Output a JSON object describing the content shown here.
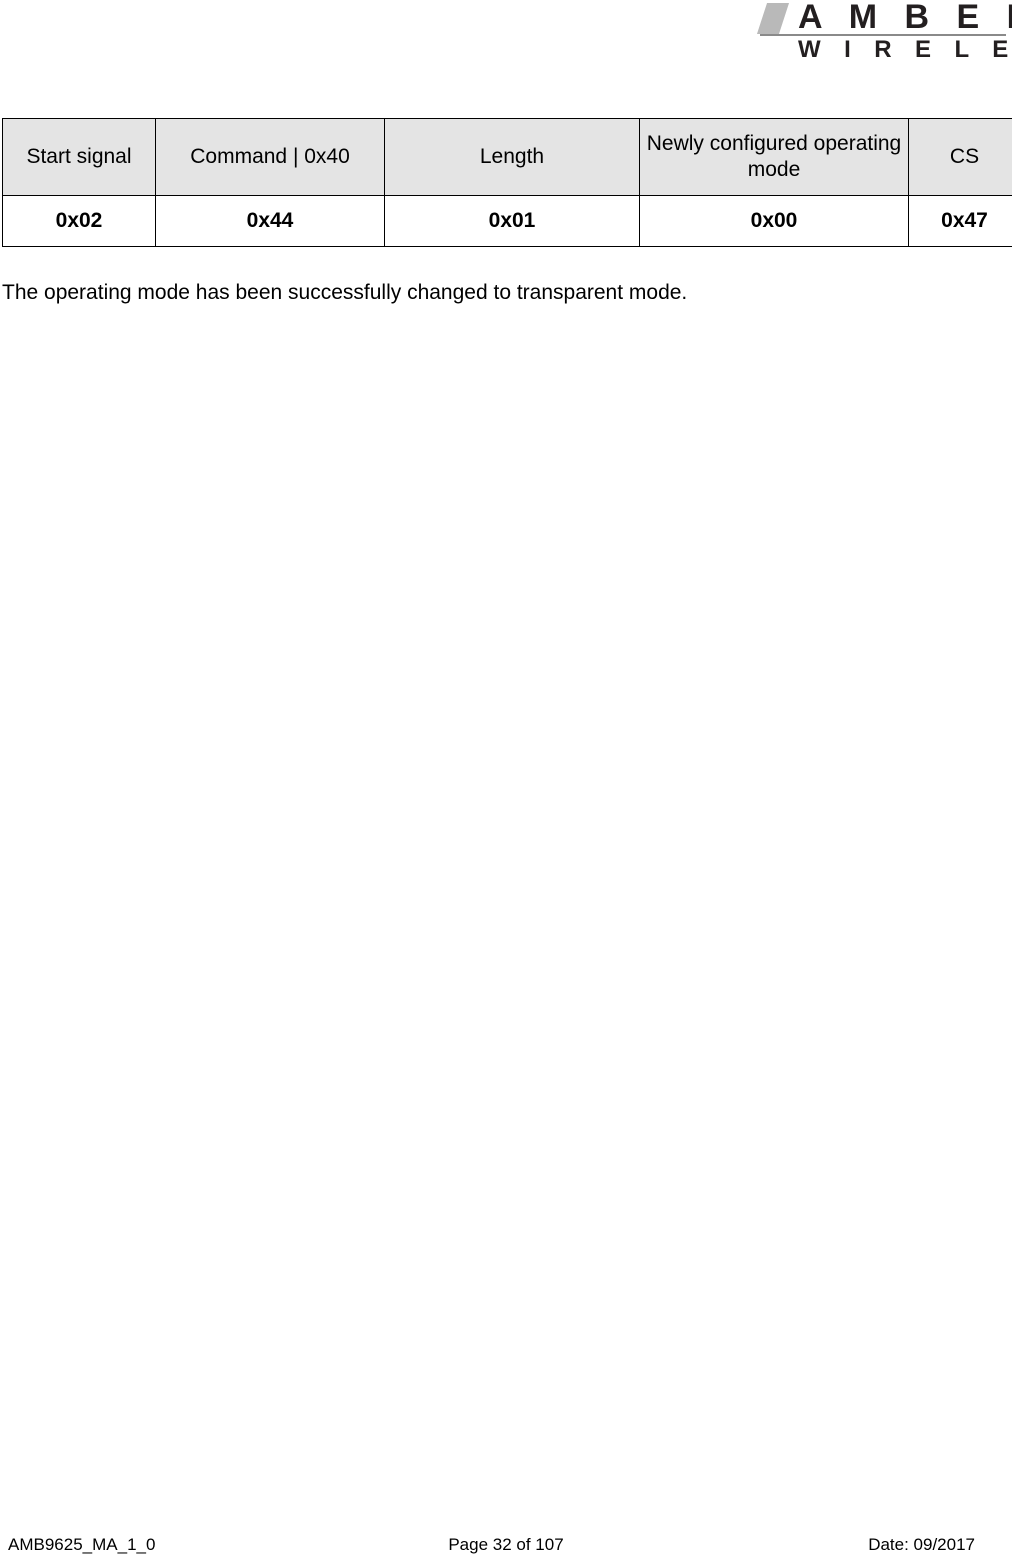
{
  "header": {
    "logo": {
      "brand_line1": "A M B E R",
      "brand_line2": "W I R E L E S S",
      "slash_color": "#b9b9b9",
      "text_color": "#231f20",
      "rule_color": "#8a8a8a"
    }
  },
  "table": {
    "header_bg": "#e4e4e4",
    "border_color": "#000000",
    "columns": [
      {
        "header": "Start signal",
        "value": "0x02"
      },
      {
        "header": "Command | 0x40",
        "value": "0x44"
      },
      {
        "header": "Length",
        "value": "0x01"
      },
      {
        "header": "Newly configured operating mode",
        "value": "0x00"
      },
      {
        "header": "CS",
        "value": "0x47"
      }
    ]
  },
  "body": {
    "paragraph": "The operating mode has been successfully changed to transparent mode."
  },
  "footer": {
    "document_id": "AMB9625_MA_1_0",
    "page_indicator": "Page 32 of 107",
    "date": "Date: 09/2017"
  }
}
